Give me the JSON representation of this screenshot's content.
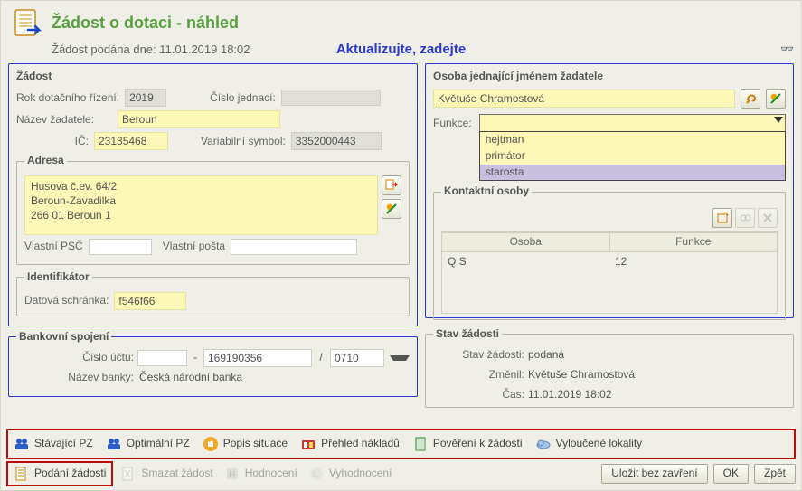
{
  "header": {
    "title": "Žádost o dotaci - náhled",
    "subtitle": "Žádost podána dne: 11.01.2019 18:02",
    "notify": "Aktualizujte, zadejte"
  },
  "zadost": {
    "legend": "Žádost",
    "rok_label": "Rok dotačního řízení:",
    "rok": "2019",
    "cj_label": "Číslo jednací:",
    "cj": "",
    "nazev_label": "Název žadatele:",
    "nazev": "Beroun",
    "ic_label": "IČ:",
    "ic": "23135468",
    "vs_label": "Variabilní symbol:",
    "vs": "3352000443"
  },
  "adresa": {
    "legend": "Adresa",
    "l1": "Husova č.ev. 64/2",
    "l2": "Beroun-Zavadilka",
    "l3": "266 01 Beroun 1",
    "psc_label": "Vlastní PSČ",
    "psc": "",
    "posta_label": "Vlastní pošta",
    "posta": ""
  },
  "ident": {
    "legend": "Identifikátor",
    "ds_label": "Datová schránka:",
    "ds": "f546f66"
  },
  "bank": {
    "legend": "Bankovní spojení",
    "cu_label": "Číslo účtu:",
    "prefix": "",
    "main": "169190356",
    "code": "0710",
    "name_label": "Název banky:",
    "name": "Česká národní banka"
  },
  "osoba": {
    "legend": "Osoba jednající jménem žadatele",
    "name": "Květuše Chramostová",
    "funkce_label": "Funkce:",
    "options": [
      "hejtman",
      "primátor",
      "starosta"
    ]
  },
  "kontakt": {
    "legend": "Kontaktní osoby",
    "cols": {
      "c1": "Osoba",
      "c2": "Funkce"
    },
    "rows": [
      {
        "osoba": "Q S",
        "funkce": "12"
      }
    ]
  },
  "stav": {
    "legend": "Stav žádosti",
    "stav_label": "Stav žádosti:",
    "stav": "podaná",
    "zmenil_label": "Změnil:",
    "zmenil": "Květuše Chramostová",
    "cas_label": "Čas:",
    "cas": "11.01.2019 18:02"
  },
  "toolbar": {
    "t1": "Stávající PZ",
    "t2": "Optimální PZ",
    "t3": "Popis situace",
    "t4": "Přehled nákladů",
    "t5": "Pověření k žádosti",
    "t6": "Vyloučené lokality"
  },
  "btnbar": {
    "b1": "Podání žádosti",
    "d1": "Smazat žádost",
    "d2": "Hodnocení",
    "d3": "Vyhodnocení",
    "save": "Uložit bez zavření",
    "ok": "OK",
    "back": "Zpět"
  }
}
